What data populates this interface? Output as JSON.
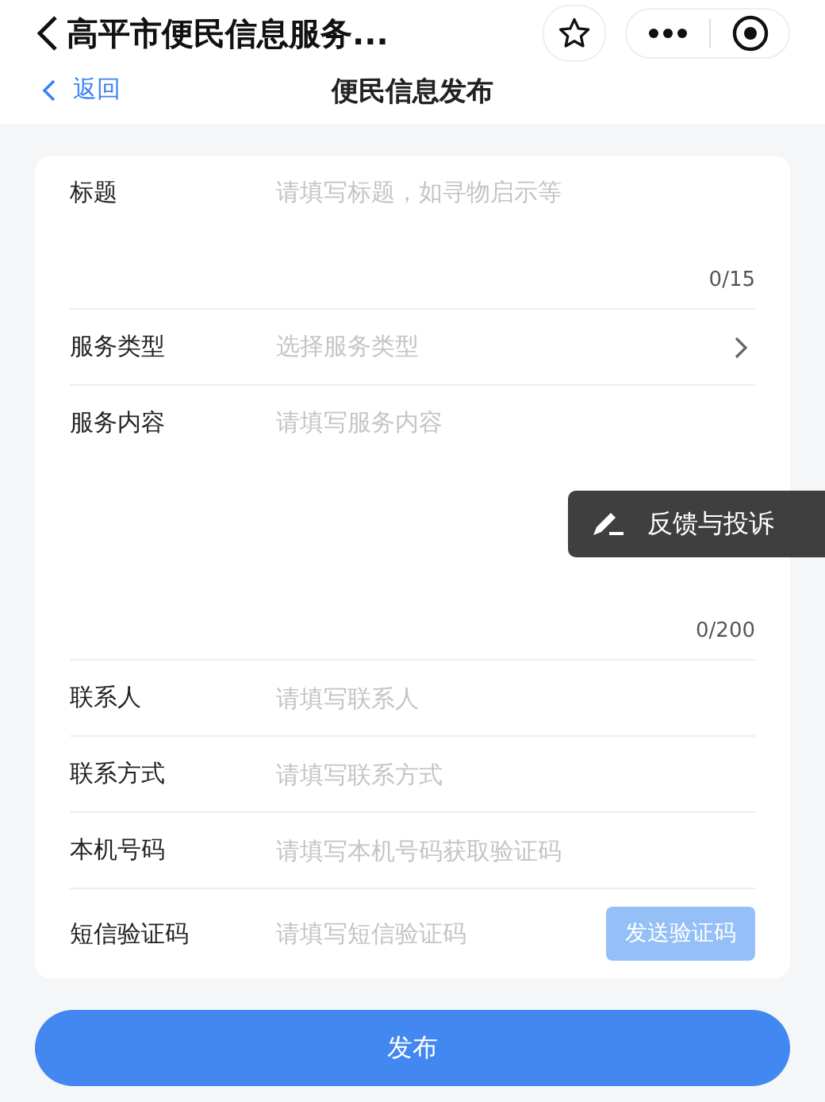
{
  "mini_program_bar": {
    "title": "高平市便民信息服务..."
  },
  "nav": {
    "back": "返回",
    "title": "便民信息发布"
  },
  "fields": [
    {
      "kind": "short_text",
      "label": "标题",
      "placeholder": "请填写标题，如寻物启示等",
      "counter": "0/15"
    },
    {
      "kind": "select",
      "label": "服务类型",
      "placeholder": "选择服务类型"
    },
    {
      "kind": "long_text",
      "label": "服务内容",
      "placeholder": "请填写服务内容",
      "counter": "0/200"
    },
    {
      "kind": "input",
      "label": "联系人",
      "placeholder": "请填写联系人"
    },
    {
      "kind": "input",
      "label": "联系方式",
      "placeholder": "请填写联系方式"
    },
    {
      "kind": "input",
      "label": "本机号码",
      "placeholder": "请填写本机号码获取验证码"
    },
    {
      "kind": "sms",
      "label": "短信验证码",
      "placeholder": "请填写短信验证码",
      "button": "发送验证码",
      "disabled": true
    }
  ],
  "submit": "发布",
  "feedback": "反馈与投诉"
}
